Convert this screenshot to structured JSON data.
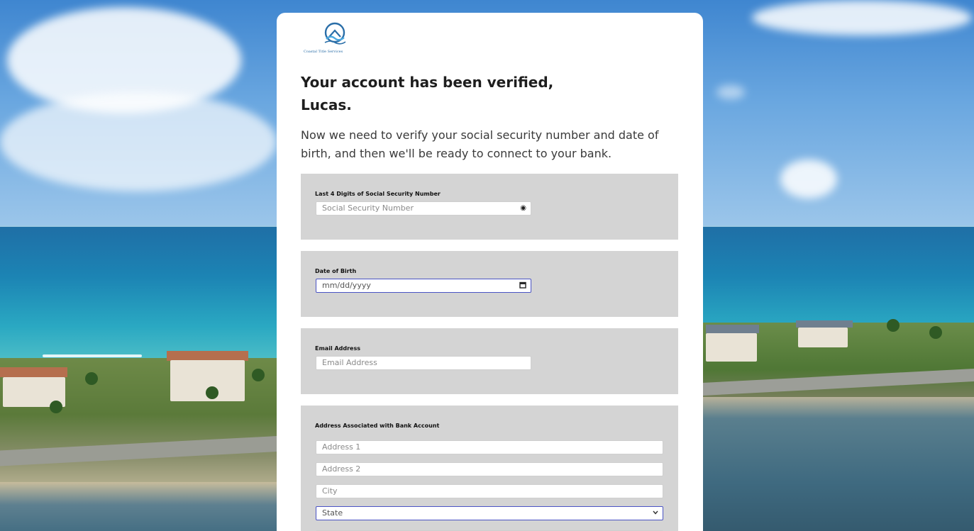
{
  "brand": {
    "logo_text": "Coastal Title Services",
    "accent": "#2a6ea8"
  },
  "heading": {
    "line1": "Your account has been verified,",
    "line2": "Lucas."
  },
  "intro": "Now we need to verify your social security number and date of birth, and then we'll be ready to connect to your bank.",
  "ssn": {
    "label": "Last 4 Digits of Social Security Number",
    "placeholder": "Social Security Number",
    "icon": "eye-icon"
  },
  "dob": {
    "label": "Date of Birth",
    "placeholder": "mm/dd/yyyy",
    "icon": "calendar-icon"
  },
  "email": {
    "label": "Email Address",
    "placeholder": "Email Address"
  },
  "address": {
    "label": "Address Associated with Bank Account",
    "address1_placeholder": "Address 1",
    "address2_placeholder": "Address 2",
    "city_placeholder": "City",
    "state_placeholder": "State",
    "state_icon": "chevron-down-icon"
  },
  "colors": {
    "panel_bg": "#d4d4d4",
    "focus_border": "#4a53c4",
    "card_bg": "#ffffff"
  }
}
